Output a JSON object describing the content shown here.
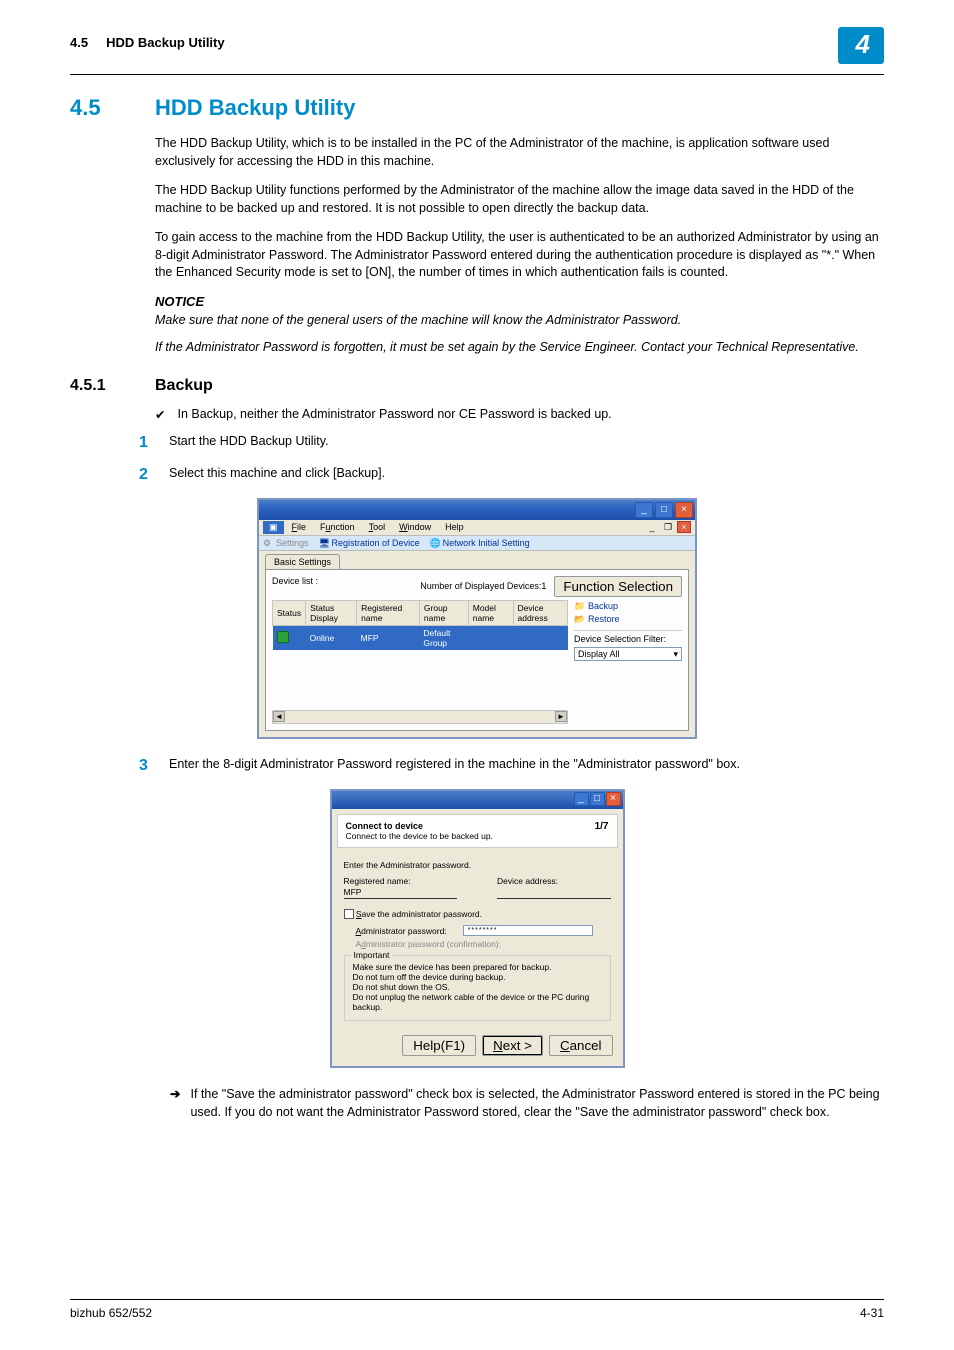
{
  "header": {
    "section_num": "4.5",
    "section_title": "HDD Backup Utility",
    "chapter": "4"
  },
  "h1": {
    "num": "4.5",
    "title": "HDD Backup Utility"
  },
  "para1": "The HDD Backup Utility, which is to be installed in the PC of the Administrator of the machine, is application software used exclusively for accessing the HDD in this machine.",
  "para2": "The HDD Backup Utility functions performed by the Administrator of the machine allow the image data saved in the HDD of the machine to be backed up and restored. It is not possible to open directly the backup data.",
  "para3": "To gain access to the machine from the HDD Backup Utility, the user is authenticated to be an authorized Administrator by using an 8-digit Administrator Password. The Administrator Password entered during the authentication procedure is displayed as \"*.\" When the Enhanced Security mode is set to [ON], the number of times in which authentication fails is counted.",
  "notice": {
    "label": "NOTICE",
    "line1": "Make sure that none of the general users of the machine will know the Administrator Password.",
    "line2": "If the Administrator Password is forgotten, it must be set again by the Service Engineer. Contact your Technical Representative."
  },
  "h2": {
    "num": "4.5.1",
    "title": "Backup"
  },
  "check1": "In Backup, neither the Administrator Password nor CE Password is backed up.",
  "step1_num": "1",
  "step1": "Start the HDD Backup Utility.",
  "step2_num": "2",
  "step2": "Select this machine and click [Backup].",
  "step3_num": "3",
  "step3": "Enter the 8-digit Administrator Password registered in the machine in the \"Administrator password\" box.",
  "arrow1": "If the \"Save the administrator password\" check box is selected, the Administrator Password entered is stored in the PC being used. If you do not want the Administrator Password stored, clear the \"Save the administrator password\" check box.",
  "footer": {
    "left": "bizhub 652/552",
    "right": "4-31"
  },
  "ss1": {
    "menu": {
      "file": "File",
      "function": "Function",
      "tool": "Tool",
      "window": "Window",
      "help": "Help"
    },
    "toolbar": {
      "settings": "Settings",
      "reg": "Registration of Device",
      "net": "Network Initial Setting"
    },
    "tab": "Basic Settings",
    "list_label": "Device list :",
    "count_label": "Number of Displayed Devices:1",
    "func_btn": "Function Selection",
    "cols": {
      "status": "Status",
      "status_display": "Status Display",
      "reg_name": "Registered name",
      "group": "Group name",
      "model": "Model name",
      "addr": "Device address"
    },
    "row": {
      "status_display": "Online",
      "reg_name": "MFP",
      "group": "Default Group",
      "model": "",
      "addr": ""
    },
    "side": {
      "backup": "Backup",
      "restore": "Restore",
      "filter": "Device Selection Filter:",
      "display": "Display All"
    }
  },
  "ss2": {
    "header_bold": "Connect to device",
    "header_sub": "Connect to the device to be backed up.",
    "page": "1/7",
    "enter_label": "Enter the Administrator password.",
    "reg_label": "Registered name:",
    "reg_value": "MFP",
    "addr_label": "Device address:",
    "save_label": "Save the administrator password.",
    "admin_label": "Administrator password:",
    "admin_value": "********",
    "confirm_label": "Administrator password (confirmation):",
    "important": "Important",
    "imp1": "Make sure the device has been prepared for backup.",
    "imp2": "Do not turn off the device during backup.",
    "imp3": "Do not shut down the OS.",
    "imp4": "Do not unplug the network cable of the device or the PC during backup.",
    "help": "Help(F1)",
    "next": "Next >",
    "cancel": "Cancel"
  }
}
